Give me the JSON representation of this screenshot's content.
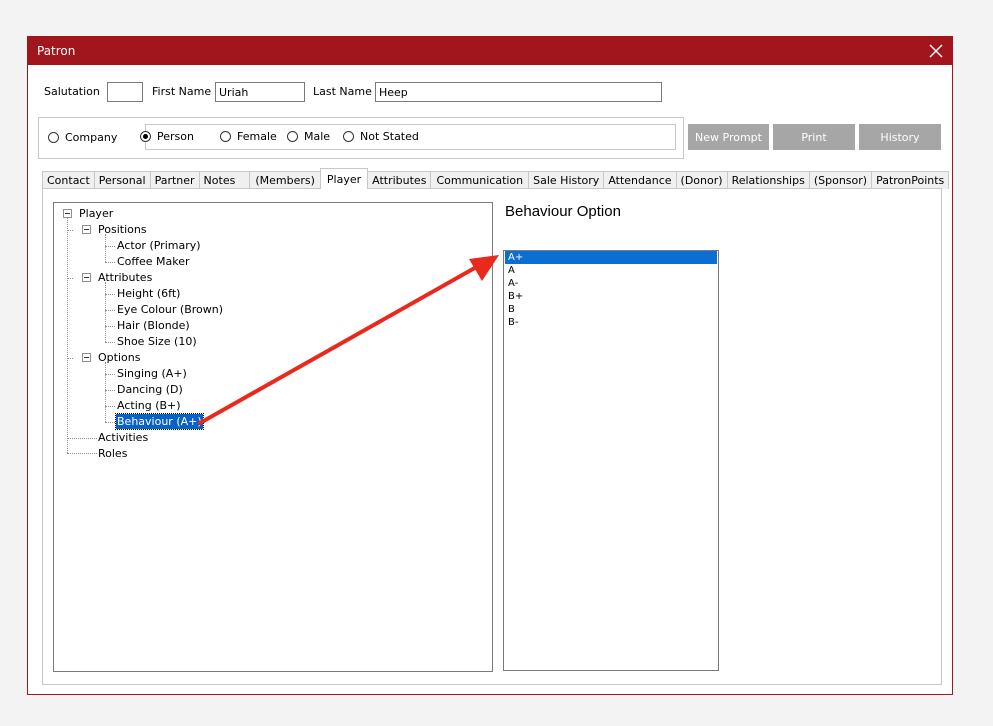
{
  "window": {
    "title": "Patron"
  },
  "header": {
    "salutation_label": "Salutation",
    "salutation_value": "",
    "first_name_label": "First Name",
    "first_name_value": "Uriah",
    "last_name_label": "Last Name",
    "last_name_value": "Heep"
  },
  "type_radios": [
    {
      "label": "Company",
      "selected": false
    },
    {
      "label": "Person",
      "selected": true
    }
  ],
  "gender_radios": [
    {
      "label": "Female",
      "selected": false
    },
    {
      "label": "Male",
      "selected": false
    },
    {
      "label": "Not Stated",
      "selected": false
    }
  ],
  "buttons": {
    "new_prompt": "New Prompt",
    "print": "Print",
    "history": "History"
  },
  "tabs": [
    "Contact",
    "Personal",
    "Partner",
    "Notes",
    "(Members)",
    "Player",
    "Attributes",
    "Communication",
    "Sale History",
    "Attendance",
    "(Donor)",
    "Relationships",
    "(Sponsor)",
    "PatronPoints"
  ],
  "active_tab": "Player",
  "tree": {
    "root": "Player",
    "positions": {
      "label": "Positions",
      "children": [
        "Actor (Primary)",
        "Coffee Maker"
      ]
    },
    "attributes": {
      "label": "Attributes",
      "children": [
        "Height (6ft)",
        "Eye Colour (Brown)",
        "Hair (Blonde)",
        "Shoe Size (10)"
      ]
    },
    "options": {
      "label": "Options",
      "children": [
        "Singing (A+)",
        "Dancing (D)",
        "Acting (B+)",
        "Behaviour (A+)"
      ]
    },
    "activities": "Activities",
    "roles": "Roles",
    "selected": "Behaviour (A+)"
  },
  "option_panel": {
    "title": "Behaviour Option",
    "items": [
      "A+",
      "A",
      "A-",
      "B+",
      "B",
      "B-"
    ],
    "selected_index": 0
  },
  "colors": {
    "titlebar": "#a0161c",
    "selection": "#0a6fd1",
    "annotation_arrow": "#e8291c",
    "button": "#a6a6a6"
  }
}
